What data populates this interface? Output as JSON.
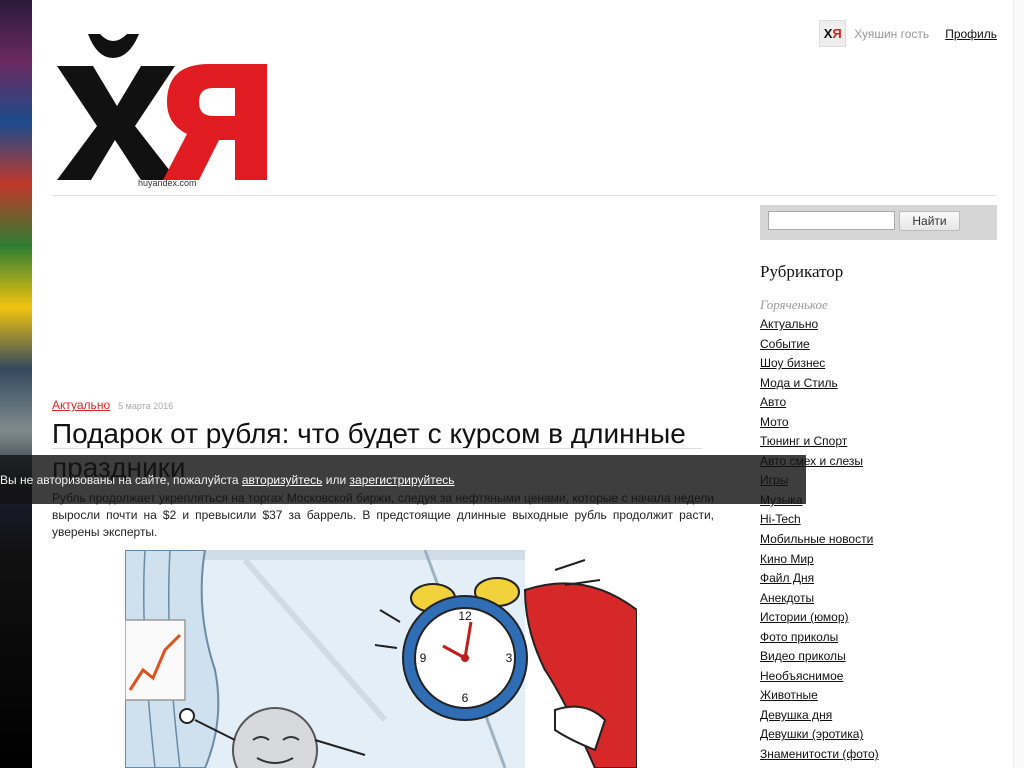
{
  "site": {
    "url_caption": "huyandex.com"
  },
  "user_bar": {
    "avatar_text_black": "Х",
    "avatar_text_red": "Я",
    "guest_label": "Хуяшин гость",
    "profile_label": "Профиль"
  },
  "article": {
    "category": "Актуально",
    "date": "5 марта 2016",
    "title": "Подарок от рубля: что будет с курсом в длинные праздники",
    "lead": "Рубль продолжает укрепляться на торгах Московской биржи, следуя за нефтяными ценами, которые с начала недели выросли почти на $2 и превысили $37 за баррель. В предстоящие длинные выходные рубль продолжит расти, уверены эксперты."
  },
  "notice": {
    "text_before": "Вы не авторизованы на сайте, пожалуйста ",
    "login_link": "авторизуйтесь",
    "text_middle": " или ",
    "register_link": "зарегистрируйтесь"
  },
  "search": {
    "input_value": "",
    "button_label": "Найти"
  },
  "rubricator": {
    "title": "Рубрикатор",
    "hot_label": "Горяченькое",
    "items": [
      "Актуально",
      "Событие",
      "Шоу бизнес",
      "Мода и Стиль",
      "Авто",
      "Мото",
      "Тюнинг и Спорт",
      "Авто смех и слезы",
      "Игры",
      "Музыка",
      "Hi-Tech",
      "Мобильные новости",
      "Кино Мир",
      "Файл Дня",
      "Анекдоты",
      "Истории (юмор)",
      "Фото приколы",
      "Видео приколы",
      "Необъяснимое",
      "Животные",
      "Девушка дня",
      "Девушки (эротика)",
      "Знаменитости (фото)"
    ]
  },
  "colors": {
    "brand_red": "#e01b22",
    "brand_black": "#111111",
    "category_link": "#d9232a",
    "search_bg": "#d6d6d6",
    "overlay_bg": "#141414"
  },
  "icons": {
    "logo": "huyandex-logo",
    "avatar": "user-avatar-icon",
    "illustration": "alarm-clock-ruble-illustration"
  }
}
